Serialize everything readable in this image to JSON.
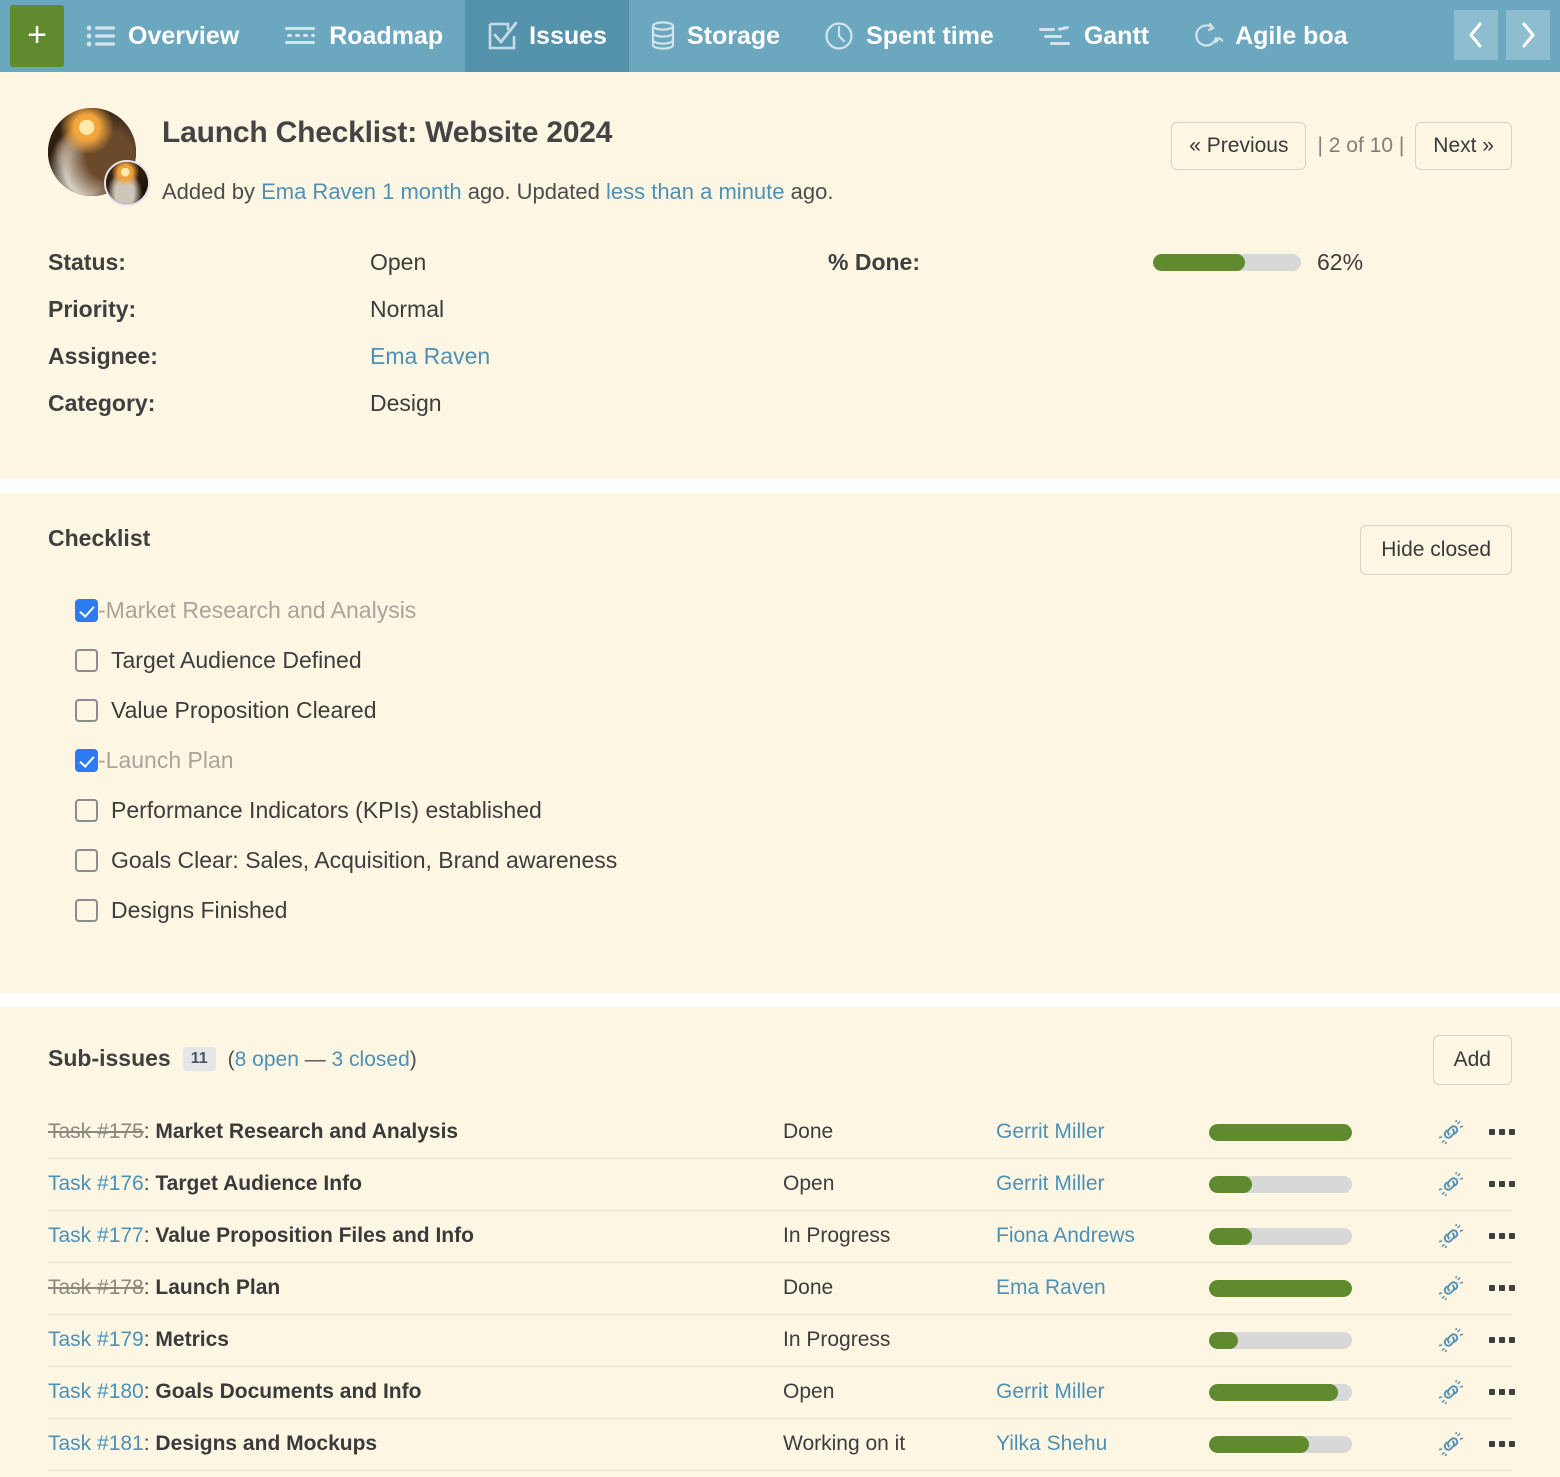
{
  "topnav": {
    "add_label": "+",
    "tabs": [
      {
        "label": "Overview",
        "icon": "list-icon",
        "active": false
      },
      {
        "label": "Roadmap",
        "icon": "roadmap-icon",
        "active": false
      },
      {
        "label": "Issues",
        "icon": "checkbox-icon",
        "active": true
      },
      {
        "label": "Storage",
        "icon": "database-icon",
        "active": false
      },
      {
        "label": "Spent time",
        "icon": "clock-icon",
        "active": false
      },
      {
        "label": "Gantt",
        "icon": "gantt-icon",
        "active": false
      },
      {
        "label": "Agile boa",
        "icon": "agile-icon",
        "active": false
      }
    ],
    "prev_arrow": "chevron-left-icon",
    "next_arrow": "chevron-right-icon",
    "colors": {
      "bar": "#6ba8c0",
      "active_tab": "#5593ad",
      "add_button": "#5f8b2e"
    }
  },
  "issue": {
    "title": "Launch Checklist: Website 2024",
    "meta": {
      "added_by_prefix": "Added by ",
      "author": "Ema Raven 1 month",
      "mid": " ago. Updated ",
      "updated": "less than a minute",
      "suffix": " ago."
    },
    "pager": {
      "previous_label": "« Previous",
      "count_label": "| 2 of 10 |",
      "next_label": "Next »"
    },
    "attributes": [
      {
        "label": "Status:",
        "value": "Open",
        "link": false
      },
      {
        "label": "Priority:",
        "value": "Normal",
        "link": false
      },
      {
        "label": "Assignee:",
        "value": "Ema Raven",
        "link": true
      },
      {
        "label": "Category:",
        "value": "Design",
        "link": false
      }
    ],
    "done": {
      "label": "% Done:",
      "percent_text": "62%",
      "percent": 62
    }
  },
  "checklist": {
    "title": "Checklist",
    "hide_closed_label": "Hide closed",
    "items": [
      {
        "label": "-Market Research and Analysis",
        "checked": true
      },
      {
        "label": "Target Audience Defined",
        "checked": false
      },
      {
        "label": "Value Proposition Cleared",
        "checked": false
      },
      {
        "label": "-Launch Plan",
        "checked": true
      },
      {
        "label": "Performance Indicators (KPIs) established",
        "checked": false
      },
      {
        "label": "Goals Clear: Sales, Acquisition, Brand awareness",
        "checked": false
      },
      {
        "label": "Designs Finished",
        "checked": false
      }
    ]
  },
  "subissues": {
    "title": "Sub-issues",
    "count_badge": "11",
    "counts_open": "8 open",
    "counts_sep": " — ",
    "counts_closed": "3 closed",
    "counts_prefix": "(",
    "counts_suffix": ")",
    "add_label": "Add",
    "rows": [
      {
        "id": "Task #175",
        "sep": ": ",
        "title": "Market Research and Analysis",
        "closed": true,
        "status": "Done",
        "assignee": "Gerrit Miller",
        "progress": 100
      },
      {
        "id": "Task #176",
        "sep": ": ",
        "title": "Target Audience Info",
        "closed": false,
        "status": "Open",
        "assignee": "Gerrit Miller",
        "progress": 30
      },
      {
        "id": "Task #177",
        "sep": ": ",
        "title": "Value Proposition Files and Info",
        "closed": false,
        "status": "In Progress",
        "assignee": "Fiona Andrews",
        "progress": 30
      },
      {
        "id": "Task #178",
        "sep": ": ",
        "title": "Launch Plan",
        "closed": true,
        "status": "Done",
        "assignee": "Ema Raven",
        "progress": 100
      },
      {
        "id": "Task #179",
        "sep": ": ",
        "title": "Metrics",
        "closed": false,
        "status": "In Progress",
        "assignee": "",
        "progress": 20
      },
      {
        "id": "Task #180",
        "sep": ": ",
        "title": "Goals Documents and Info",
        "closed": false,
        "status": "Open",
        "assignee": "Gerrit Miller",
        "progress": 90
      },
      {
        "id": "Task #181",
        "sep": ": ",
        "title": "Designs and Mockups",
        "closed": false,
        "status": "Working on it",
        "assignee": "Yilka Shehu",
        "progress": 70
      }
    ],
    "row_icons": {
      "unlink": "unlink-icon",
      "menu": "more-options-icon"
    }
  }
}
